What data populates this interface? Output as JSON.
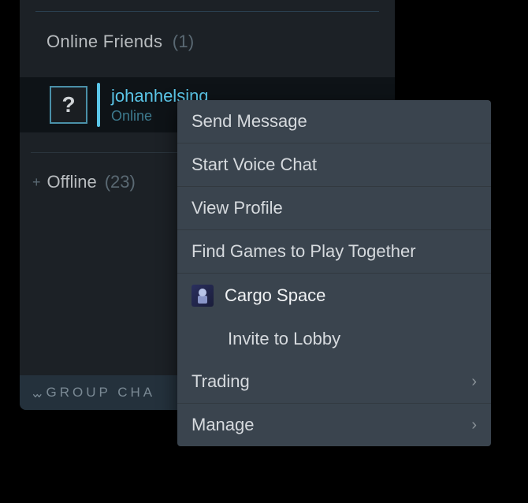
{
  "sections": {
    "online": {
      "title": "Online Friends",
      "count": "(1)"
    },
    "offline": {
      "title": "Offline",
      "count": "(23)"
    }
  },
  "friend": {
    "name": "johanhelsing",
    "status": "Online",
    "avatar_placeholder": "?"
  },
  "group_chats": {
    "label": "GROUP CHA"
  },
  "context_menu": {
    "send_message": "Send Message",
    "voice_chat": "Start Voice Chat",
    "view_profile": "View Profile",
    "find_games": "Find Games to Play Together",
    "game_name": "Cargo Space",
    "invite_lobby": "Invite to Lobby",
    "trading": "Trading",
    "manage": "Manage"
  }
}
